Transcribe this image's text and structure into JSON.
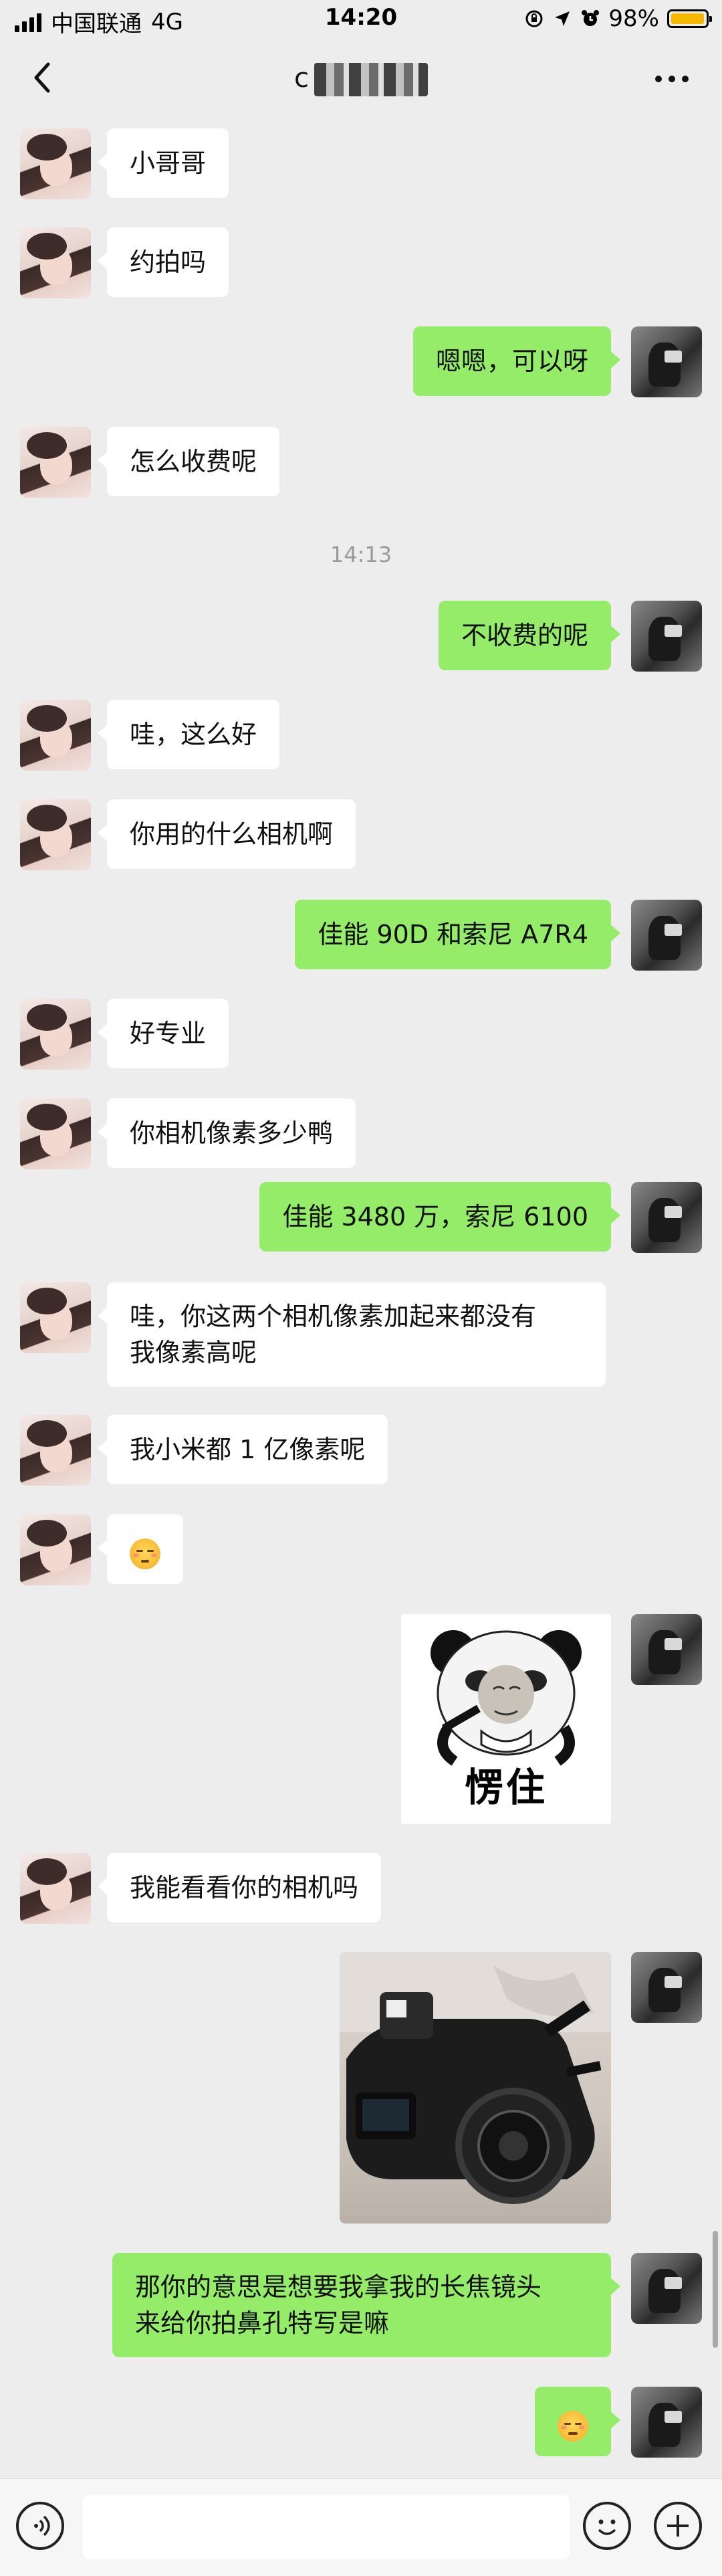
{
  "status_bar": {
    "carrier": "中国联通",
    "network": "4G",
    "time": "14:20",
    "battery_percent": "98%",
    "battery_level": 0.98,
    "battery_color": "#f5b800"
  },
  "nav": {
    "back_icon": "chevron-left-icon",
    "title_visible": "c",
    "more_icon": "more-dots-icon"
  },
  "colors": {
    "background": "#ededed",
    "incoming_bubble": "#ffffff",
    "outgoing_bubble": "#95ec69",
    "timestamp_text": "#999999"
  },
  "timestamp": "14:13",
  "messages": [
    {
      "side": "in",
      "text": "小哥哥"
    },
    {
      "side": "in",
      "text": "约拍吗"
    },
    {
      "side": "out",
      "text": "嗯嗯，可以呀"
    },
    {
      "side": "in",
      "text": "怎么收费呢"
    },
    {
      "side": "out",
      "text": "不收费的呢"
    },
    {
      "side": "in",
      "text": "哇，这么好"
    },
    {
      "side": "in",
      "text": "你用的什么相机啊"
    },
    {
      "side": "out",
      "text": "佳能 90D 和索尼 A7R4"
    },
    {
      "side": "in",
      "text": "好专业"
    },
    {
      "side": "in",
      "text": "你相机像素多少鸭"
    },
    {
      "side": "out",
      "text": "佳能 3480 万，索尼 6100"
    },
    {
      "side": "in",
      "line1": "哇，你这两个相机像素加起来都没有",
      "line2": "我像素高呢"
    },
    {
      "side": "in",
      "text": "我小米都 1 亿像素呢"
    },
    {
      "side": "in",
      "emoji": "shy-face-emoji"
    },
    {
      "side": "out",
      "sticker_text": "愣住",
      "sticker": "panda-meme-sticker"
    },
    {
      "side": "in",
      "text": "我能看看你的相机吗"
    },
    {
      "side": "out",
      "photo": "camera-photo"
    },
    {
      "side": "out",
      "line1": "那你的意思是想要我拿我的长焦镜头",
      "line2": "来给你拍鼻孔特写是嘛"
    },
    {
      "side": "out",
      "emoji": "unamused-face-emoji"
    }
  ],
  "input_bar": {
    "voice_icon": "voice-icon",
    "emoji_icon": "emoji-icon",
    "plus_icon": "plus-icon",
    "placeholder": ""
  }
}
